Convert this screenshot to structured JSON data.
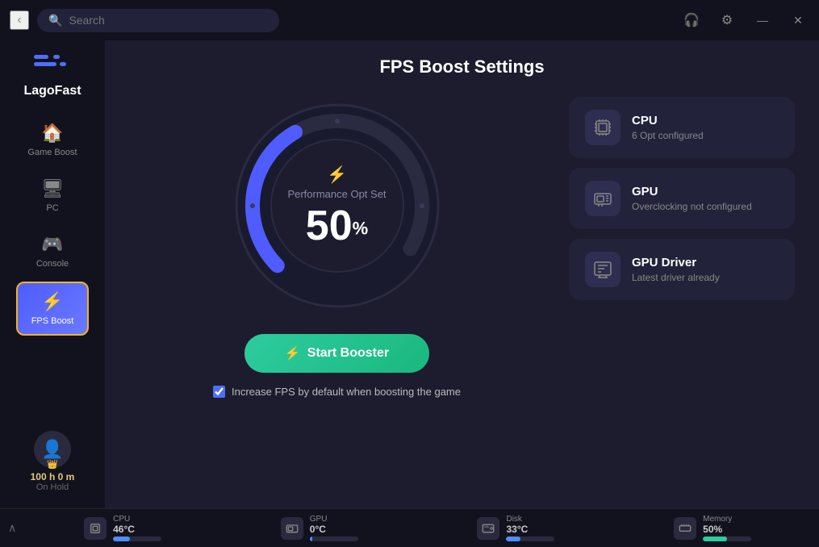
{
  "app": {
    "title": "LagoFast",
    "logo_text": "LagoFast"
  },
  "titlebar": {
    "search_placeholder": "Search",
    "back_label": "‹",
    "headset_icon": "🎧",
    "settings_icon": "⚙",
    "minimize_icon": "—",
    "close_icon": "✕"
  },
  "sidebar": {
    "items": [
      {
        "label": "Game Boost",
        "icon": "🏠",
        "active": false
      },
      {
        "label": "PC",
        "icon": "🖥",
        "active": false
      },
      {
        "label": "Console",
        "icon": "🎮",
        "active": false
      },
      {
        "label": "FPS Boost",
        "icon": "⚡",
        "active": true
      }
    ],
    "user": {
      "time_h": "100",
      "time_m": "0",
      "time_label": "h",
      "time_m_label": "m",
      "status": "On Hold",
      "crown_icon": "👑"
    }
  },
  "main": {
    "title": "FPS Boost Settings",
    "gauge": {
      "lightning_icon": "⚡",
      "label": "Performance Opt Set",
      "value": "50",
      "unit": "%",
      "percentage": 50
    },
    "start_button": {
      "icon": "⚡",
      "label": "Start Booster"
    },
    "checkbox": {
      "label": "Increase FPS by default when boosting the game",
      "checked": true
    },
    "stat_cards": [
      {
        "title": "CPU",
        "description": "6 Opt configured",
        "icon": "🔧"
      },
      {
        "title": "GPU",
        "description": "Overclocking not configured",
        "icon": "📷"
      },
      {
        "title": "GPU Driver",
        "description": "Latest driver already",
        "icon": "💾"
      }
    ]
  },
  "statusbar": {
    "chevron": "∧",
    "items": [
      {
        "label": "CPU",
        "value": "46°C",
        "icon": "🔧",
        "fill_percent": 35,
        "color": "blue"
      },
      {
        "label": "GPU",
        "value": "0°C",
        "icon": "📷",
        "fill_percent": 5,
        "color": "blue"
      },
      {
        "label": "Disk",
        "value": "33°C",
        "icon": "💿",
        "fill_percent": 30,
        "color": "blue"
      },
      {
        "label": "Memory",
        "value": "50%",
        "icon": "🗃",
        "fill_percent": 50,
        "color": "teal"
      }
    ]
  }
}
